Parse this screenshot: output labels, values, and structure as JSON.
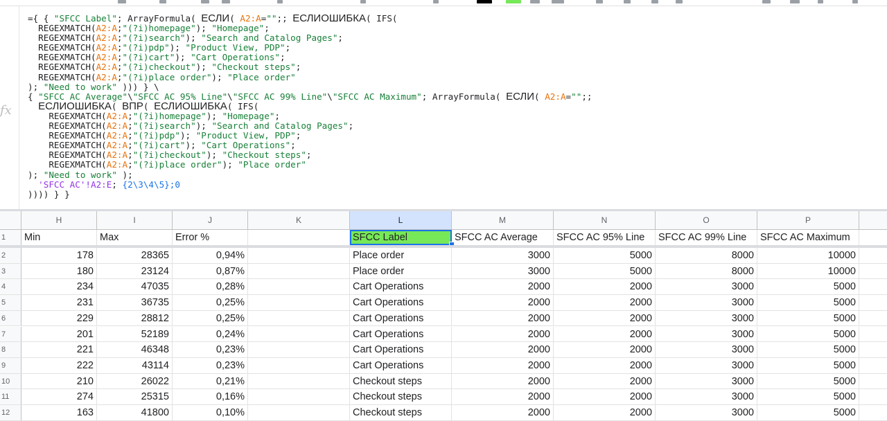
{
  "formula": {
    "fx_label": "fx",
    "lines": [
      "={ { \"SFCC Label\"; ArrayFormula( ЕСЛИ( A2:A=\"\";; ЕСЛИОШИБКА( IFS(",
      "REGEXMATCH(A2:A;\"(?i)homepage\"); \"Homepage\";",
      "REGEXMATCH(A2:A;\"(?i)search\"); \"Search and Catalog Pages\";",
      "REGEXMATCH(A2:A;\"(?i)pdp\"); \"Product View, PDP\";",
      "REGEXMATCH(A2:A;\"(?i)cart\"); \"Cart Operations\";",
      "REGEXMATCH(A2:A;\"(?i)checkout\"); \"Checkout steps\";",
      "REGEXMATCH(A2:A;\"(?i)place order\"); \"Place order\"",
      "); \"Need to work\" ))) } \\",
      "{ \"SFCC AC Average\"\\\"SFCC AC 95% Line\"\\\"SFCC AC 99% Line\"\\\"SFCC AC Maximum\"; ArrayFormula( ЕСЛИ( A2:A=\"\";;",
      "ЕСЛИОШИБКА( ВПР( ЕСЛИОШИБКА( IFS(",
      "REGEXMATCH(A2:A;\"(?i)homepage\"); \"Homepage\";",
      "REGEXMATCH(A2:A;\"(?i)search\"); \"Search and Catalog Pages\";",
      "REGEXMATCH(A2:A;\"(?i)pdp\"); \"Product View, PDP\";",
      "REGEXMATCH(A2:A;\"(?i)cart\"); \"Cart Operations\";",
      "REGEXMATCH(A2:A;\"(?i)checkout\"); \"Checkout steps\";",
      "REGEXMATCH(A2:A;\"(?i)place order\"); \"Place order\"",
      "); \"Need to work\" );",
      "'SFCC AC'!A2:E; {2\\3\\4\\5};0",
      ")))) } }"
    ]
  },
  "columns": [
    "H",
    "I",
    "J",
    "K",
    "L",
    "M",
    "N",
    "O",
    "P"
  ],
  "selected_column": "L",
  "header_row": {
    "number": "1",
    "cells": [
      "Min",
      "Max",
      "Error %",
      "",
      "SFCC Label",
      "SFCC AC Average",
      "SFCC AC 95% Line",
      "SFCC AC 99% Line",
      "SFCC AC Maximum"
    ]
  },
  "rows": [
    {
      "number": "2",
      "cells": [
        "178",
        "28365",
        "0,94%",
        "",
        "Place order",
        "3000",
        "5000",
        "8000",
        "10000"
      ]
    },
    {
      "number": "3",
      "cells": [
        "180",
        "23124",
        "0,87%",
        "",
        "Place order",
        "3000",
        "5000",
        "8000",
        "10000"
      ]
    },
    {
      "number": "4",
      "cells": [
        "234",
        "47035",
        "0,28%",
        "",
        "Cart Operations",
        "2000",
        "2000",
        "3000",
        "5000"
      ]
    },
    {
      "number": "5",
      "cells": [
        "231",
        "36735",
        "0,25%",
        "",
        "Cart Operations",
        "2000",
        "2000",
        "3000",
        "5000"
      ]
    },
    {
      "number": "6",
      "cells": [
        "229",
        "28812",
        "0,25%",
        "",
        "Cart Operations",
        "2000",
        "2000",
        "3000",
        "5000"
      ]
    },
    {
      "number": "7",
      "cells": [
        "201",
        "52189",
        "0,24%",
        "",
        "Cart Operations",
        "2000",
        "2000",
        "3000",
        "5000"
      ]
    },
    {
      "number": "8",
      "cells": [
        "221",
        "46348",
        "0,23%",
        "",
        "Cart Operations",
        "2000",
        "2000",
        "3000",
        "5000"
      ]
    },
    {
      "number": "9",
      "cells": [
        "222",
        "43114",
        "0,23%",
        "",
        "Cart Operations",
        "2000",
        "2000",
        "3000",
        "5000"
      ]
    },
    {
      "number": "10",
      "cells": [
        "210",
        "26022",
        "0,21%",
        "",
        "Checkout steps",
        "2000",
        "2000",
        "3000",
        "5000"
      ]
    },
    {
      "number": "11",
      "cells": [
        "274",
        "25315",
        "0,16%",
        "",
        "Checkout steps",
        "2000",
        "2000",
        "3000",
        "5000"
      ]
    },
    {
      "number": "12",
      "cells": [
        "163",
        "41800",
        "0,10%",
        "",
        "Checkout steps",
        "2000",
        "2000",
        "3000",
        "5000"
      ]
    }
  ],
  "colors": {
    "selected_cell_fill": "#77e858",
    "selection_border": "#1a73e8",
    "string_literal": "#188038",
    "range_reference": "#e8710a",
    "sheet_reference": "#9334e6",
    "number_literal": "#1a73e8"
  }
}
